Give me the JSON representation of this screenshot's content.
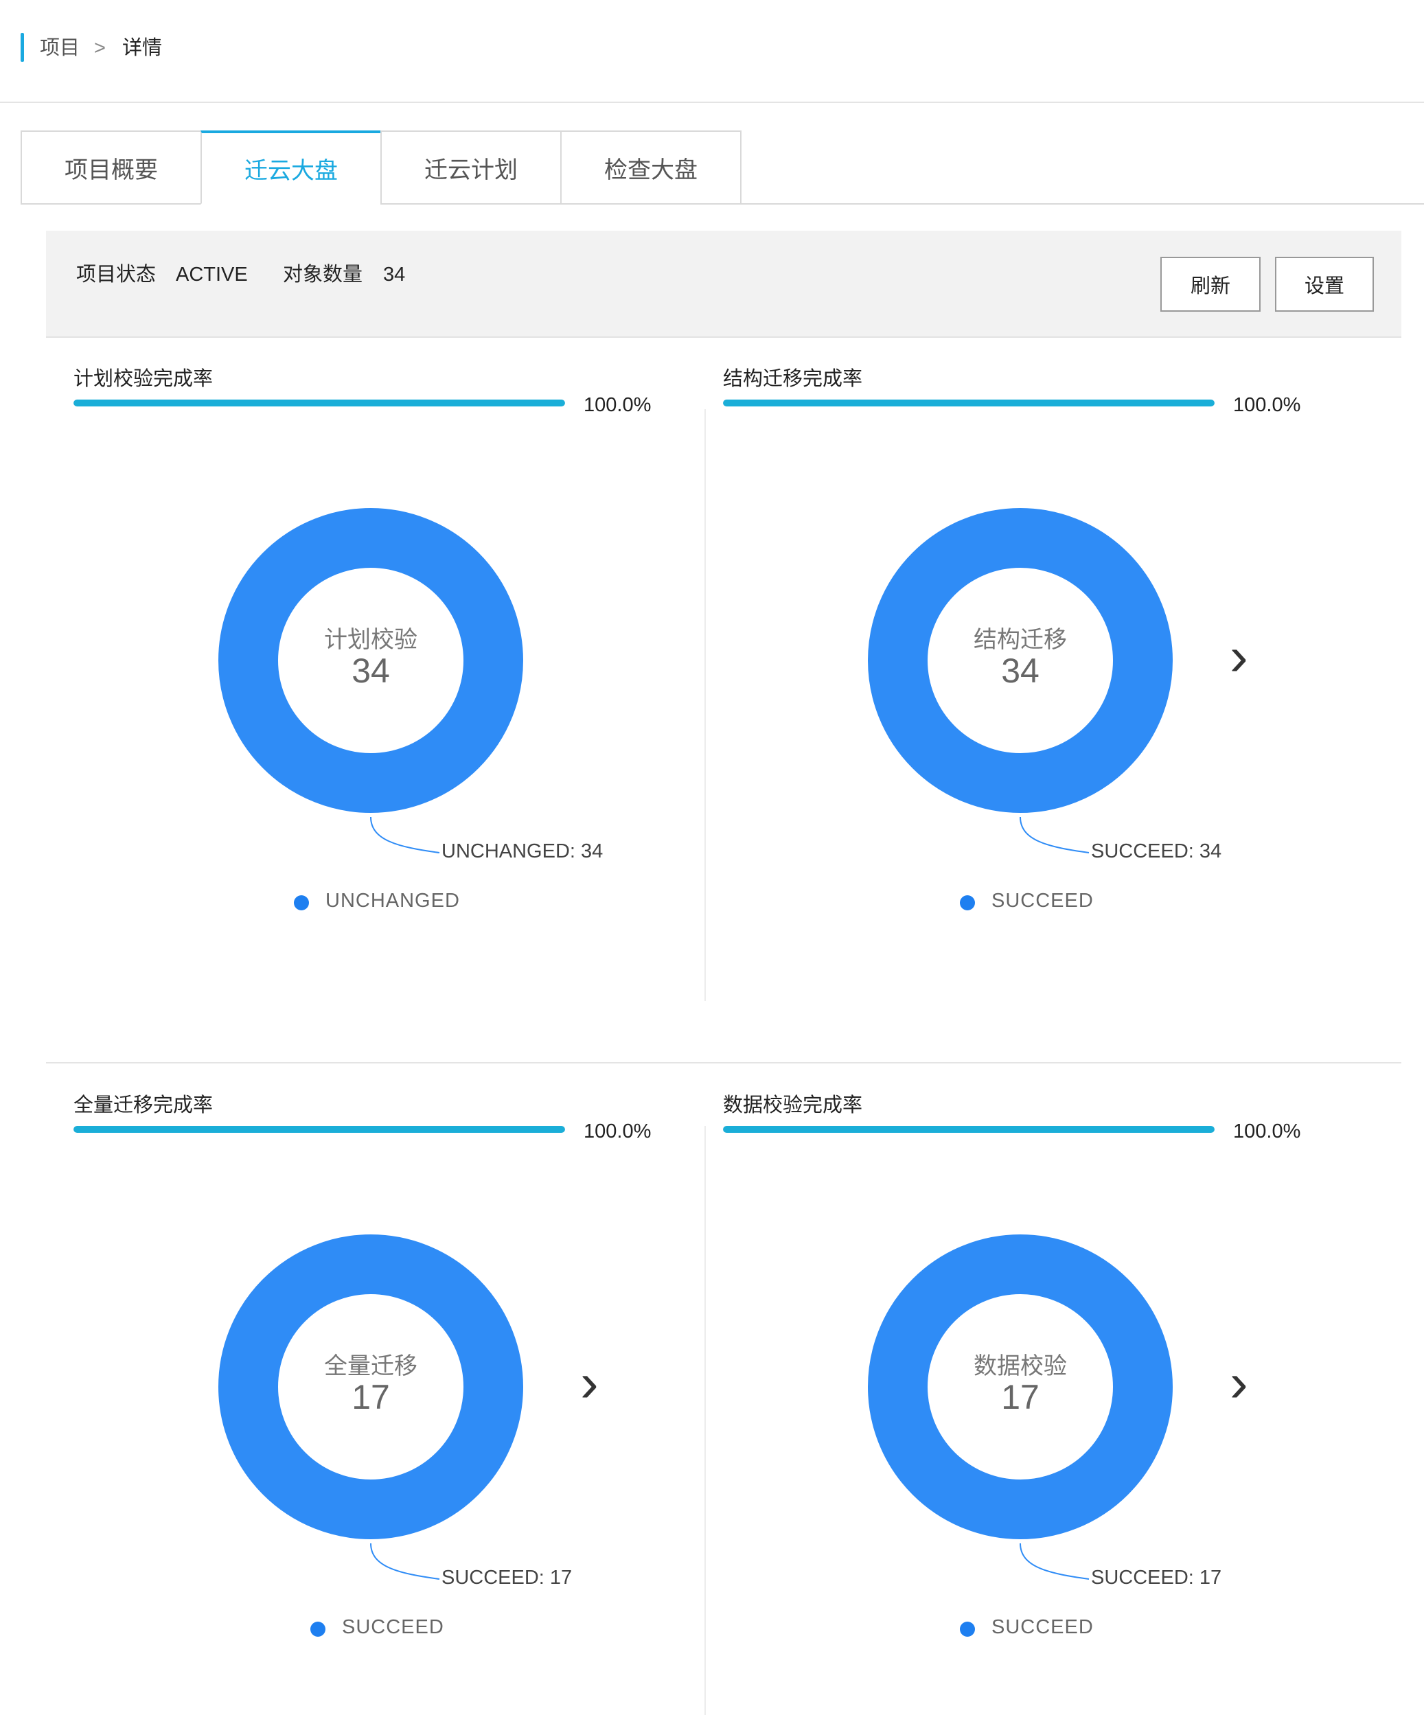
{
  "breadcrumb": {
    "root": "项目",
    "separator": ">",
    "current": "详情"
  },
  "tabs": [
    {
      "label": "项目概要"
    },
    {
      "label": "迁云大盘"
    },
    {
      "label": "迁云计划"
    },
    {
      "label": "检查大盘"
    }
  ],
  "active_tab": "迁云大盘",
  "status": {
    "state_label": "项目状态",
    "state_value": "ACTIVE",
    "count_label": "对象数量",
    "count_value": "34",
    "refresh_label": "刷新",
    "settings_label": "设置"
  },
  "colors": {
    "accent": "#1aa9e0",
    "progress": "#1aaed8",
    "donut": "#2f8cf6",
    "legend_dot": "#1e7ff0"
  },
  "panels": [
    {
      "title": "计划校验完成率",
      "progress": 1.0,
      "percent_text": "100.0%",
      "center_label": "计划校验",
      "center_value": "34",
      "callout": "UNCHANGED: 34",
      "legend": "UNCHANGED",
      "has_arrow": false,
      "arrow_icon": ""
    },
    {
      "title": "结构迁移完成率",
      "progress": 1.0,
      "percent_text": "100.0%",
      "center_label": "结构迁移",
      "center_value": "34",
      "callout": "SUCCEED: 34",
      "legend": "SUCCEED",
      "has_arrow": true,
      "arrow_icon": "chevron-right-icon"
    },
    {
      "title": "全量迁移完成率",
      "progress": 1.0,
      "percent_text": "100.0%",
      "center_label": "全量迁移",
      "center_value": "17",
      "callout": "SUCCEED: 17",
      "legend": "SUCCEED",
      "has_arrow": true,
      "arrow_icon": "chevron-right-icon"
    },
    {
      "title": "数据校验完成率",
      "progress": 1.0,
      "percent_text": "100.0%",
      "center_label": "数据校验",
      "center_value": "17",
      "callout": "SUCCEED: 17",
      "legend": "SUCCEED",
      "has_arrow": true,
      "arrow_icon": "chevron-right-icon"
    }
  ]
}
